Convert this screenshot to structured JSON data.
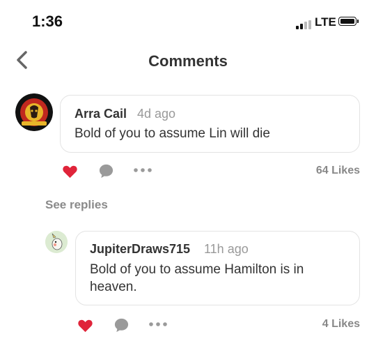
{
  "status": {
    "time": "1:36",
    "network": "LTE"
  },
  "header": {
    "title": "Comments"
  },
  "comments": [
    {
      "user": "Arra Cail",
      "age": "4d ago",
      "text": "Bold of you to assume Lin will die",
      "likes": "64 Likes",
      "liked": true
    }
  ],
  "see_replies": "See replies",
  "replies": [
    {
      "user": "JupiterDraws715",
      "age": "11h ago",
      "text_line1": "Bold of you to assume Hamilton is in",
      "text_line2": "heaven.",
      "likes": "4 Likes",
      "liked": true
    }
  ],
  "colors": {
    "heart": "#e0243a",
    "icon_gray": "#9a9a9a"
  },
  "icons": [
    "back-chevron-icon",
    "heart-icon",
    "comment-bubble-icon",
    "more-dots-icon"
  ]
}
